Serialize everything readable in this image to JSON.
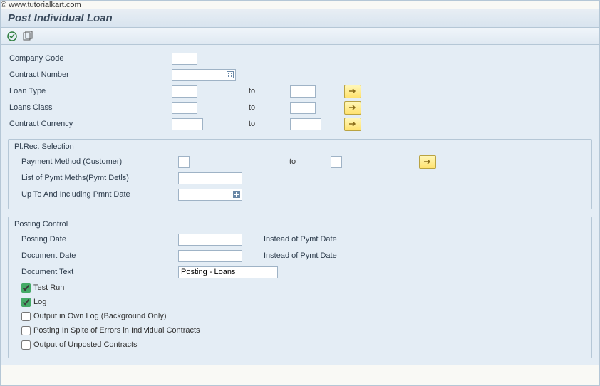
{
  "title": "Post Individual Loan",
  "watermark": "© www.tutorialkart.com",
  "toolbar": {
    "execute_icon": "execute-icon",
    "variant_icon": "variant-icon"
  },
  "main": {
    "company_code": {
      "label": "Company Code",
      "value": ""
    },
    "contract_number": {
      "label": "Contract Number",
      "value": ""
    },
    "loan_type": {
      "label": "Loan Type",
      "from": "",
      "to_label": "to",
      "to": ""
    },
    "loans_class": {
      "label": "Loans Class",
      "from": "",
      "to_label": "to",
      "to": ""
    },
    "contract_currency": {
      "label": "Contract Currency",
      "from": "",
      "to_label": "to",
      "to": ""
    }
  },
  "plrec": {
    "title": "Pl.Rec. Selection",
    "payment_method": {
      "label": "Payment Method (Customer)",
      "from": "",
      "to_label": "to",
      "to": ""
    },
    "list_pymt_meths": {
      "label": "List of Pymt Meths(Pymt Detls)",
      "value": ""
    },
    "up_to_date": {
      "label": "Up To And Including Pmnt Date",
      "value": ""
    }
  },
  "posting": {
    "title": "Posting Control",
    "posting_date": {
      "label": "Posting Date",
      "value": "",
      "note": "Instead of Pymt Date"
    },
    "document_date": {
      "label": "Document Date",
      "value": "",
      "note": "Instead of Pymt Date"
    },
    "document_text": {
      "label": "Document Text",
      "value": "Posting - Loans"
    },
    "test_run": {
      "label": "Test Run",
      "checked": true
    },
    "log": {
      "label": "Log",
      "checked": true
    },
    "own_log": {
      "label": "Output in Own Log (Background Only)",
      "checked": false
    },
    "spite_errors": {
      "label": "Posting In Spite of Errors in Individual Contracts",
      "checked": false
    },
    "unposted": {
      "label": "Output of Unposted Contracts",
      "checked": false
    }
  }
}
